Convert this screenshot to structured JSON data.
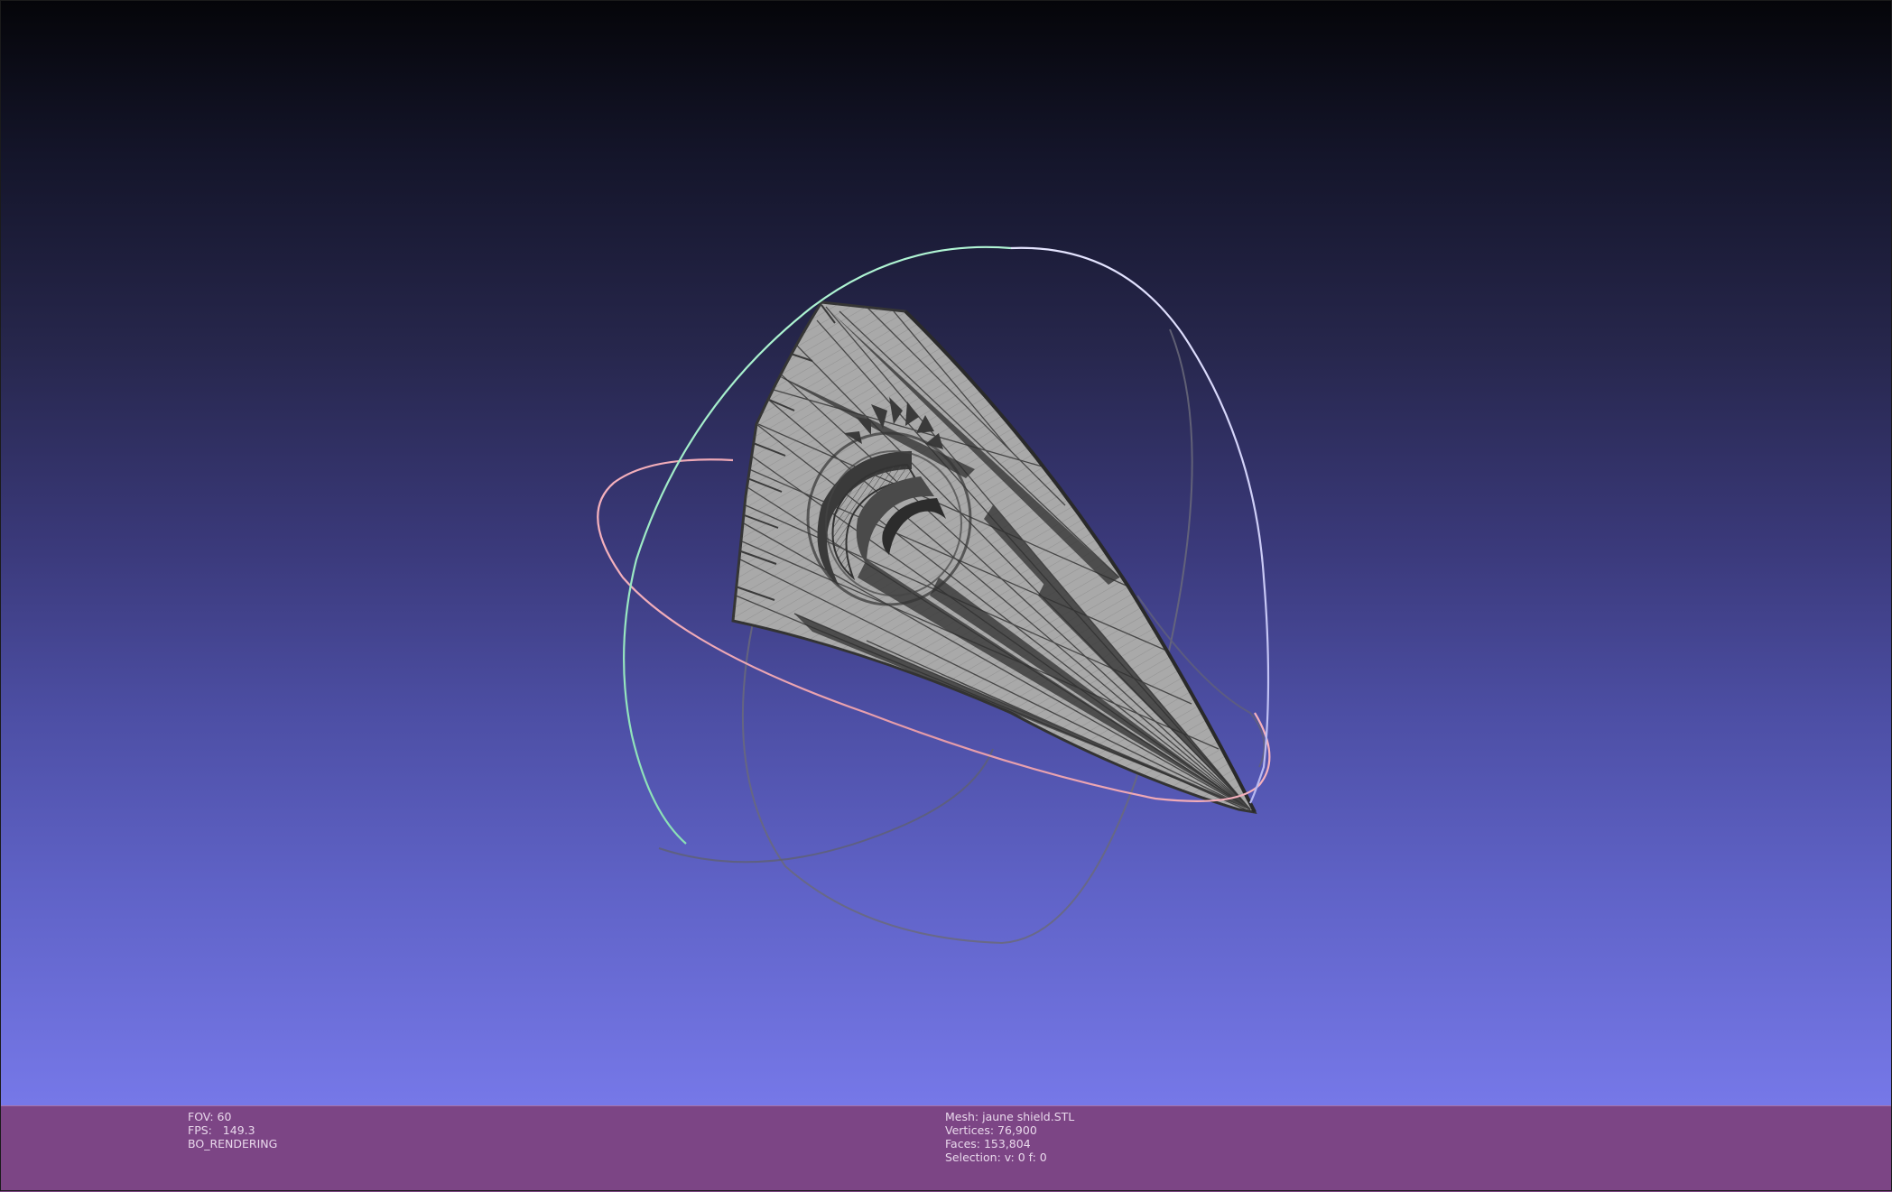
{
  "viewer": {
    "background": {
      "top_color": "#050509",
      "bottom_color": "#7678e8"
    },
    "mesh_fill_color": "#a9a9a9",
    "wireframe_color": "#3a3a3a",
    "trackball": {
      "horizontal_ring_color": "#f0a8b4",
      "vertical_ring_color": "#9cf0c4",
      "depth_ring_color": "#c8c8f8"
    }
  },
  "status": {
    "left": {
      "fov": "FOV: 60",
      "fps": "FPS:   149.3",
      "mode": "BO_RENDERING"
    },
    "right": {
      "mesh": "Mesh: jaune shield.STL",
      "vertices": "Vertices: 76,900",
      "faces": "Faces: 153,804",
      "selection": "Selection: v: 0 f: 0"
    },
    "bar_color": "#7c4585"
  }
}
